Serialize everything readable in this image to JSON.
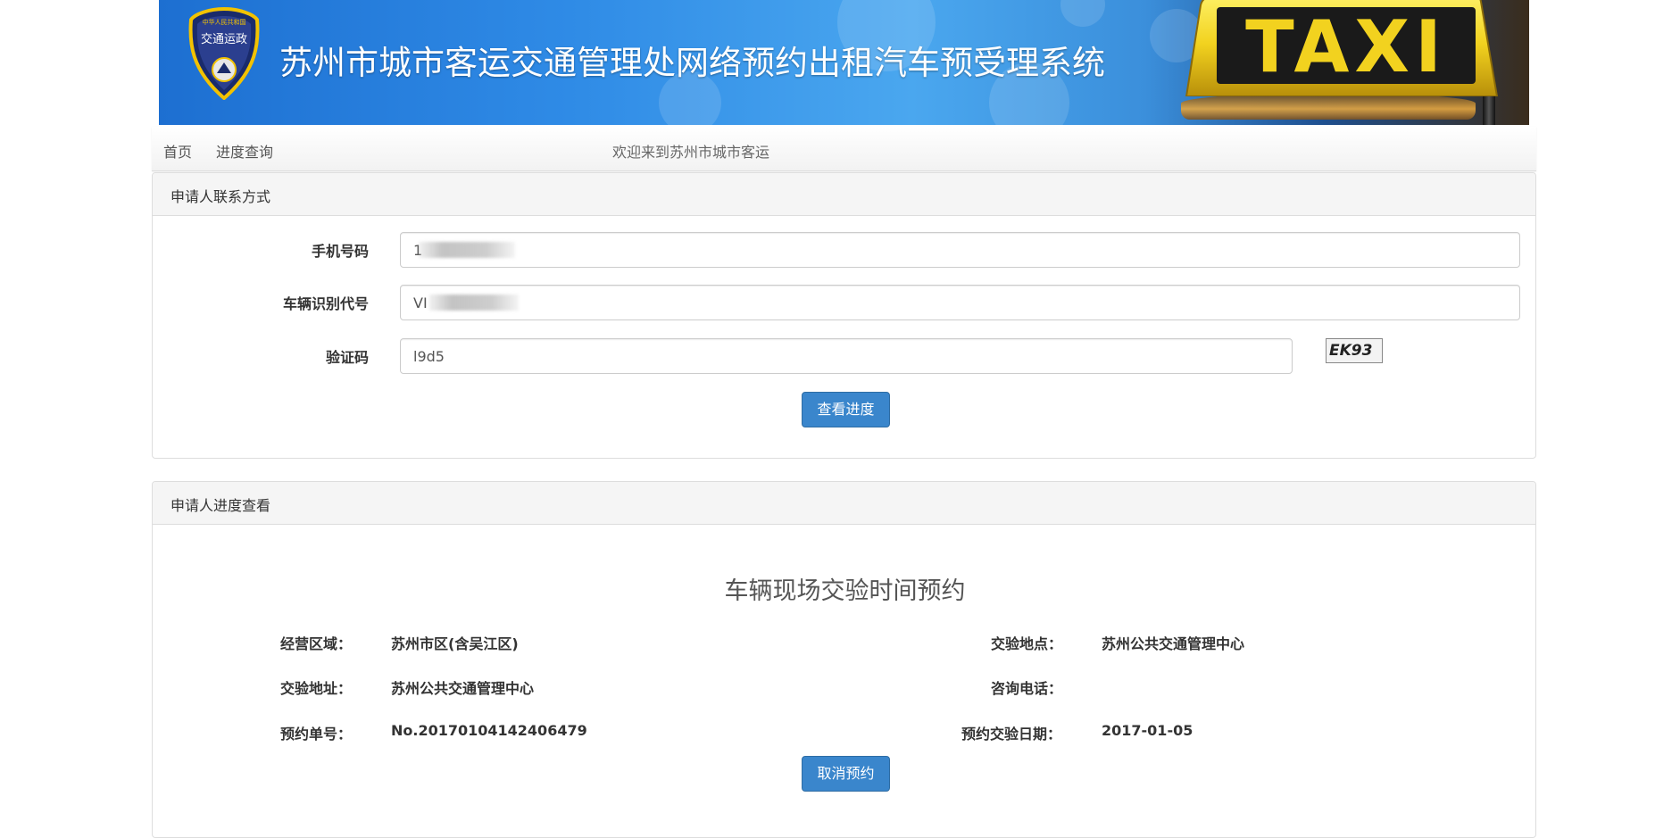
{
  "banner": {
    "title": "苏州市城市客运交通管理处网络预约出租汽车预受理系统",
    "emblem_text": "交通运政",
    "sign_text": "TAXI"
  },
  "nav": {
    "home": "首页",
    "progress_query": "进度查询",
    "welcome": "欢迎来到苏州市城市客运"
  },
  "contact_panel": {
    "heading": "申请人联系方式",
    "phone": {
      "label": "手机号码",
      "value": "1"
    },
    "vin": {
      "label": "车辆识别代号",
      "value": "VI"
    },
    "captcha": {
      "label": "验证码",
      "value": "l9d5",
      "image_text": "EK93"
    },
    "submit_label": "查看进度"
  },
  "progress_panel": {
    "heading": "申请人进度查看",
    "title": "车辆现场交验时间预约",
    "fields": {
      "area": {
        "label": "经营区域：",
        "value": "苏州市区(含吴江区)"
      },
      "inspection_place": {
        "label": "交验地点：",
        "value": "苏州公共交通管理中心"
      },
      "inspection_address": {
        "label": "交验地址：",
        "value": "苏州公共交通管理中心"
      },
      "hotline": {
        "label": "咨询电话：",
        "value": ""
      },
      "order_no": {
        "label": "预约单号：",
        "value": "No.20170104142406479"
      },
      "inspection_date": {
        "label": "预约交验日期：",
        "value": "2017-01-05"
      }
    },
    "cancel_label": "取消预约"
  },
  "colors": {
    "primary_button": "#3a86cc",
    "panel_heading_bg": "#f5f5f5",
    "border": "#dddddd",
    "banner_blue": "#2f8be6",
    "taxi_yellow": "#f2d21f"
  }
}
